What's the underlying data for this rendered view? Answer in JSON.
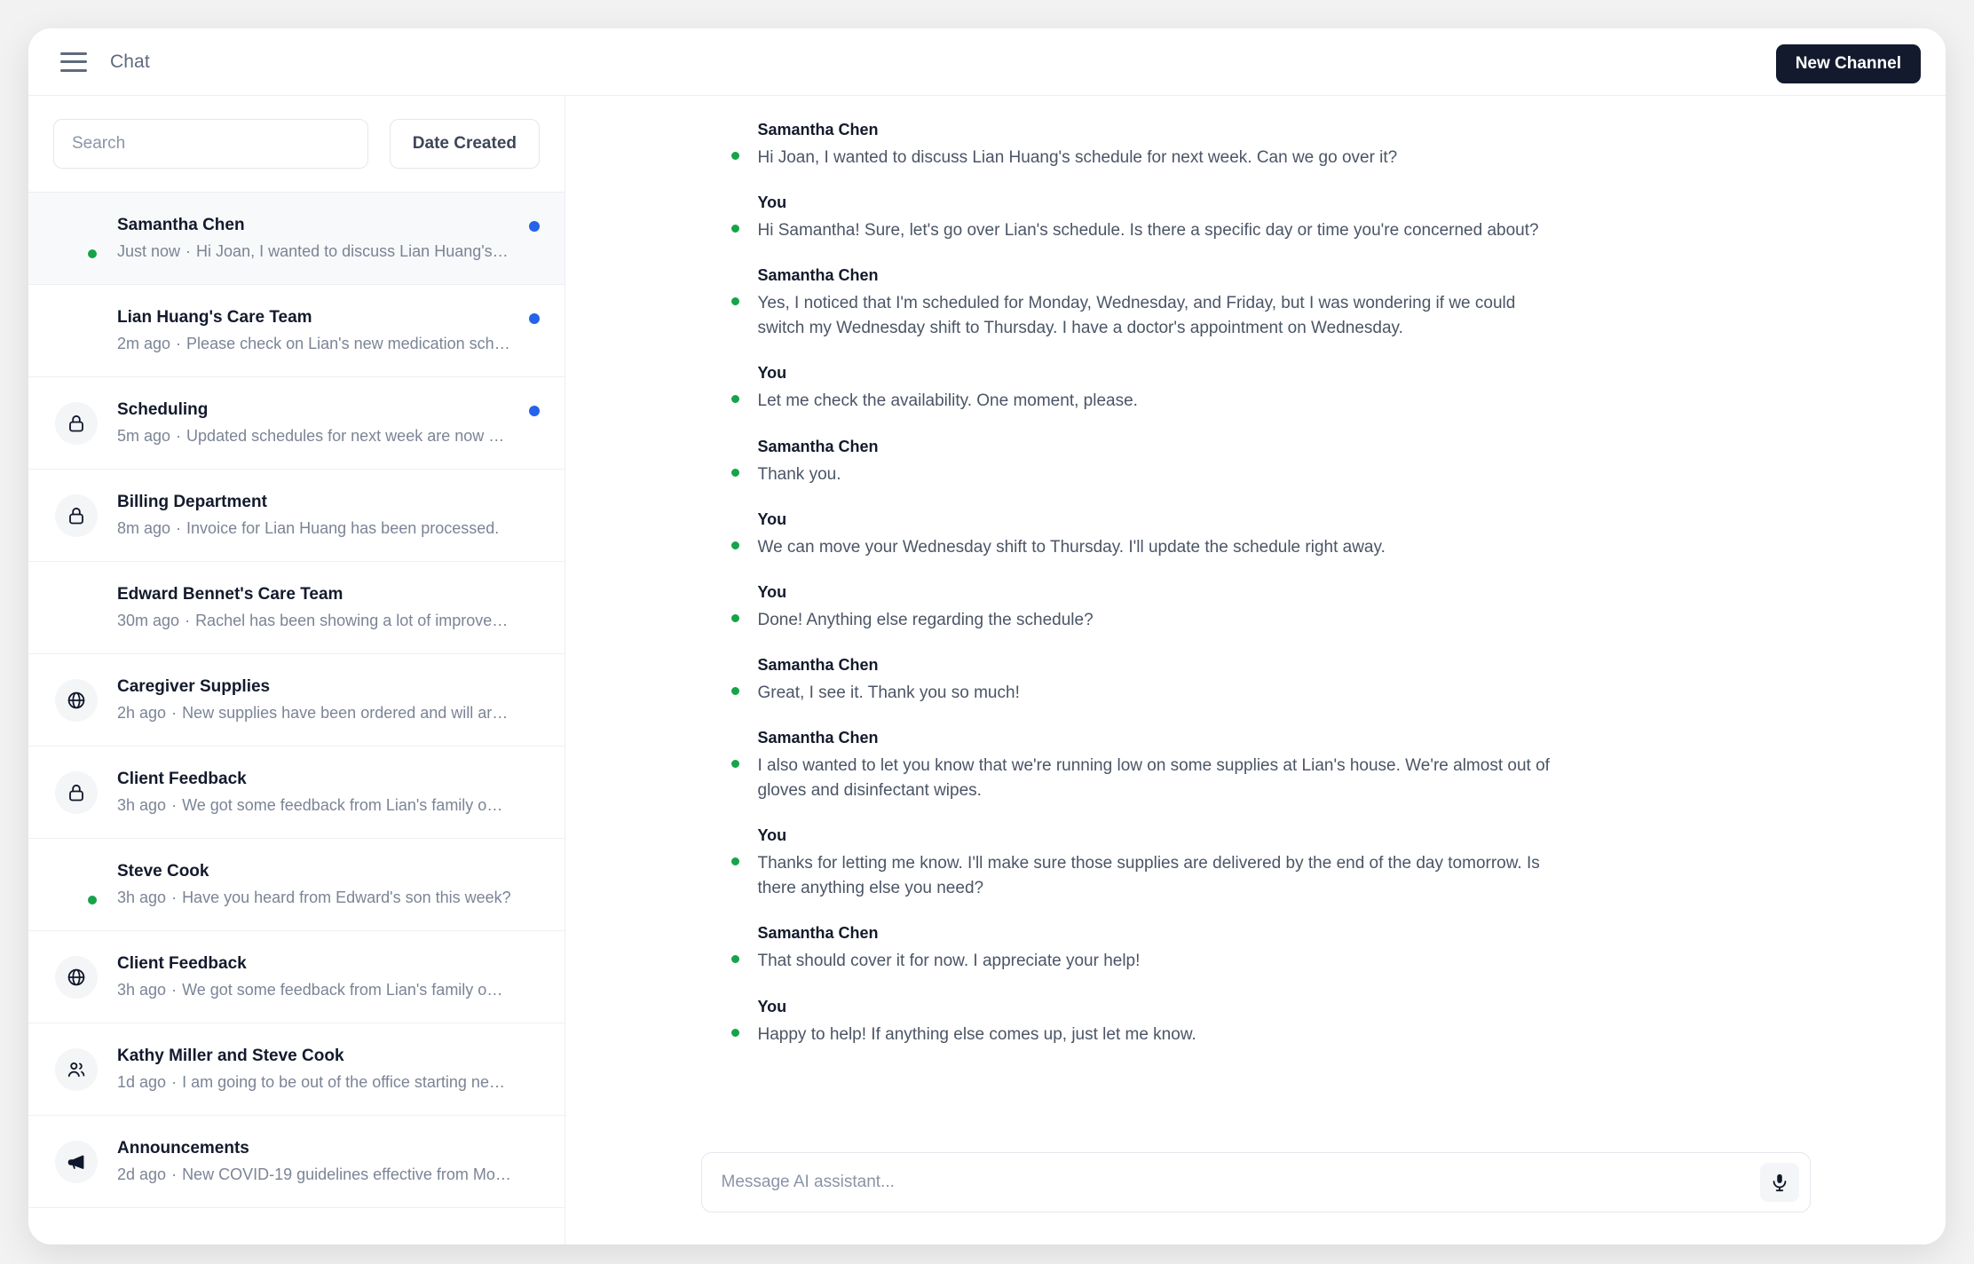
{
  "topbar": {
    "menu_icon": "hamburger-menu-icon",
    "title": "Chat",
    "new_channel_label": "New Channel",
    "new_channel_color": "#141a2e"
  },
  "sidebar": {
    "search_placeholder": "Search",
    "search_value": "",
    "sort_label": "Date Created",
    "unread_dot_color": "#2563eb",
    "presence_color": "#16a34a",
    "items": [
      {
        "title": "Samantha Chen",
        "time": "Just now",
        "preview": "Hi Joan, I wanted to discuss Lian Huang's sc…",
        "avatar_type": "photo",
        "avatar": "woman-dark-hair",
        "online": true,
        "unread": true,
        "selected": true
      },
      {
        "title": "Lian Huang's Care Team",
        "time": "2m ago",
        "preview": "Please check on Lian's new medication sched…",
        "avatar_type": "photo",
        "avatar": "elderly-woman-gray-hair",
        "online": false,
        "unread": true,
        "selected": false
      },
      {
        "title": "Scheduling",
        "time": "5m ago",
        "preview": "Updated schedules for next week are now ava…",
        "avatar_type": "icon",
        "avatar": "lock-icon",
        "online": false,
        "unread": true,
        "selected": false
      },
      {
        "title": "Billing Department",
        "time": "8m ago",
        "preview": "Invoice for Lian Huang has been processed.",
        "avatar_type": "icon",
        "avatar": "lock-icon",
        "online": false,
        "unread": false,
        "selected": false
      },
      {
        "title": "Edward Bennet's Care Team",
        "time": "30m ago",
        "preview": "Rachel has been showing a lot of improveme…",
        "avatar_type": "photo",
        "avatar": "elderly-man-white-hair",
        "online": false,
        "unread": false,
        "selected": false
      },
      {
        "title": "Caregiver Supplies",
        "time": "2h ago",
        "preview": "New supplies have been ordered and will arriv…",
        "avatar_type": "icon",
        "avatar": "globe-icon",
        "online": false,
        "unread": false,
        "selected": false
      },
      {
        "title": "Client Feedback",
        "time": "3h ago",
        "preview": "We got some feedback from Lian's family on o…",
        "avatar_type": "icon",
        "avatar": "lock-icon",
        "online": false,
        "unread": false,
        "selected": false
      },
      {
        "title": "Steve Cook",
        "time": "3h ago",
        "preview": "Have you heard from Edward's son this week?",
        "avatar_type": "photo",
        "avatar": "man-dark-hair",
        "online": true,
        "unread": false,
        "selected": false
      },
      {
        "title": "Client Feedback",
        "time": "3h ago",
        "preview": "We got some feedback from Lian's family on o…",
        "avatar_type": "icon",
        "avatar": "globe-icon",
        "online": false,
        "unread": false,
        "selected": false
      },
      {
        "title": "Kathy Miller and Steve Cook",
        "time": "1d ago",
        "preview": "I am going to be out of the office starting next…",
        "avatar_type": "icon",
        "avatar": "users-icon",
        "online": false,
        "unread": false,
        "selected": false
      },
      {
        "title": "Announcements",
        "time": "2d ago",
        "preview": "New COVID-19 guidelines effective from Mond…",
        "avatar_type": "icon",
        "avatar": "megaphone-icon",
        "online": false,
        "unread": false,
        "selected": false
      }
    ]
  },
  "thread": {
    "messages": [
      {
        "author": "Samantha Chen",
        "avatar": "woman-dark-hair",
        "online": true,
        "text": "Hi Joan, I wanted to discuss Lian Huang's schedule for next week. Can we go over it?"
      },
      {
        "author": "You",
        "avatar": "woman-short-hair",
        "online": true,
        "text": "Hi Samantha! Sure, let's go over Lian's schedule. Is there a specific day or time you're concerned about?"
      },
      {
        "author": "Samantha Chen",
        "avatar": "woman-dark-hair",
        "online": true,
        "text": "Yes, I noticed that I'm scheduled for Monday, Wednesday, and Friday, but I was wondering if we could switch my Wednesday shift to Thursday. I have a doctor's appointment on Wednesday."
      },
      {
        "author": "You",
        "avatar": "woman-short-hair",
        "online": true,
        "text": "Let me check the availability. One moment, please."
      },
      {
        "author": "Samantha Chen",
        "avatar": "woman-dark-hair",
        "online": true,
        "text": "Thank you."
      },
      {
        "author": "You",
        "avatar": "woman-short-hair",
        "online": true,
        "text": "We can move your Wednesday shift to Thursday. I'll update the schedule right away."
      },
      {
        "author": "You",
        "avatar": "woman-short-hair",
        "online": true,
        "text": "Done! Anything else regarding the schedule?"
      },
      {
        "author": "Samantha Chen",
        "avatar": "woman-dark-hair",
        "online": true,
        "text": "Great, I see it. Thank you so much!"
      },
      {
        "author": "Samantha Chen",
        "avatar": "woman-dark-hair",
        "online": true,
        "text": "I also wanted to let you know that we're running low on some supplies at Lian's house. We're almost out of gloves and disinfectant wipes."
      },
      {
        "author": "You",
        "avatar": "woman-short-hair",
        "online": true,
        "text": "Thanks for letting me know. I'll make sure those supplies are delivered by the end of the day tomorrow. Is there anything else you need?"
      },
      {
        "author": "Samantha Chen",
        "avatar": "woman-dark-hair",
        "online": true,
        "text": "That should cover it for now. I appreciate your help!"
      },
      {
        "author": "You",
        "avatar": "woman-short-hair",
        "online": true,
        "text": "Happy to help! If anything else comes up, just let me know."
      }
    ]
  },
  "composer": {
    "placeholder": "Message AI assistant...",
    "value": "",
    "mic_icon": "microphone-icon"
  }
}
